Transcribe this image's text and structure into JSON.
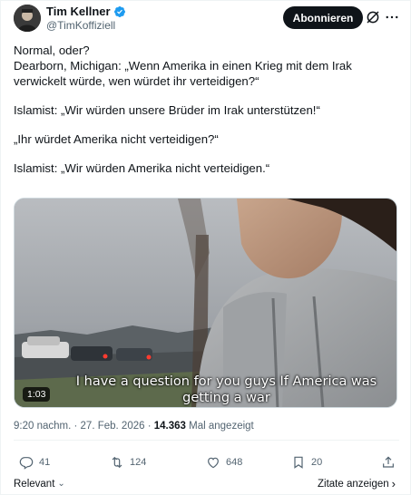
{
  "author": {
    "name": "Tim Kellner",
    "handle": "@TimKoffiziell",
    "verified": true
  },
  "header": {
    "follow_label": "Abonnieren",
    "grok_icon": "grok-icon",
    "more_icon": "more-icon"
  },
  "tweet": {
    "lines": [
      "Normal, oder?",
      "Dearborn, Michigan: „Wenn Amerika in einen Krieg mit dem Irak verwickelt würde, wen würdet ihr verteidigen?“",
      "Islamist: „Wir würden unsere Brüder im Irak unterstützen!“",
      "„Ihr würdet Amerika nicht verteidigen?“",
      "Islamist: „Wir würden Amerika nicht verteidigen.“"
    ]
  },
  "media": {
    "caption_line1": "I have a question for you guys If America was",
    "caption_line2": "getting a war",
    "duration": "1:03"
  },
  "meta": {
    "time": "9:20 nachm.",
    "separator": " · ",
    "date": "27. Feb. 2026",
    "views_count": "14.363",
    "views_label": "Mal angezeigt"
  },
  "actions": {
    "replies": "41",
    "reposts": "124",
    "likes": "648",
    "bookmarks": "20"
  },
  "footer": {
    "sort_label": "Relevant",
    "quotes_label": "Zitate anzeigen"
  },
  "colors": {
    "text": "#0f1419",
    "secondary": "#536471",
    "verified": "#1d9bf0",
    "follow_bg": "#0f1419"
  }
}
